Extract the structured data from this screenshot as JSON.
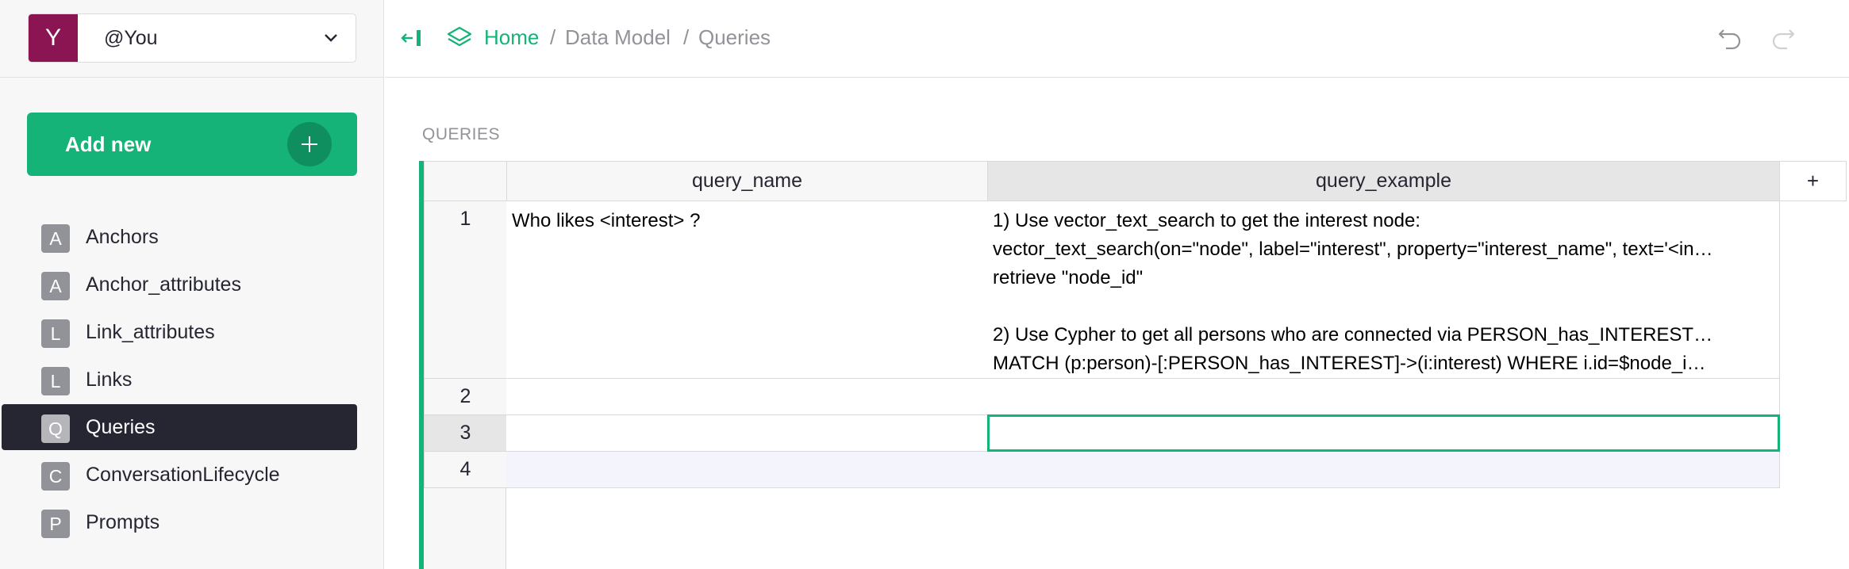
{
  "account": {
    "avatar_letter": "Y",
    "name": "@You"
  },
  "sidebar": {
    "add_new_label": "Add new",
    "items": [
      {
        "badge": "A",
        "label": "Anchors",
        "active": false
      },
      {
        "badge": "A",
        "label": "Anchor_attributes",
        "active": false
      },
      {
        "badge": "L",
        "label": "Link_attributes",
        "active": false
      },
      {
        "badge": "L",
        "label": "Links",
        "active": false
      },
      {
        "badge": "Q",
        "label": "Queries",
        "active": true
      },
      {
        "badge": "C",
        "label": "ConversationLifecycle",
        "active": false
      },
      {
        "badge": "P",
        "label": "Prompts",
        "active": false
      }
    ]
  },
  "breadcrumb": {
    "home": "Home",
    "separator": "/",
    "data_model": "Data Model",
    "current": "Queries"
  },
  "section": {
    "title": "QUERIES"
  },
  "table": {
    "columns": [
      "query_name",
      "query_example"
    ],
    "add_column_label": "+",
    "rows": [
      {
        "num": "1",
        "query_name": "Who likes <interest> ?",
        "query_example_lines": [
          "1) Use vector_text_search to get the interest node:",
          "vector_text_search(on=\"node\", label=\"interest\", property=\"interest_name\", text='<in…",
          "retrieve \"node_id\"",
          "",
          "2) Use Cypher to get all persons who are connected via PERSON_has_INTEREST…",
          "MATCH (p:person)-[:PERSON_has_INTEREST]->(i:interest) WHERE i.id=$node_i…"
        ]
      },
      {
        "num": "2",
        "query_name": "",
        "query_example_lines": []
      },
      {
        "num": "3",
        "query_name": "",
        "query_example_lines": []
      },
      {
        "num": "4",
        "query_name": "",
        "query_example_lines": []
      }
    ]
  },
  "colors": {
    "accent": "#16b378",
    "avatar": "#8b1553",
    "active_nav": "#262633"
  },
  "icons": [
    "chevron-down-icon",
    "plus-icon",
    "collapse-panel-icon",
    "layers-icon",
    "undo-icon",
    "redo-icon"
  ]
}
